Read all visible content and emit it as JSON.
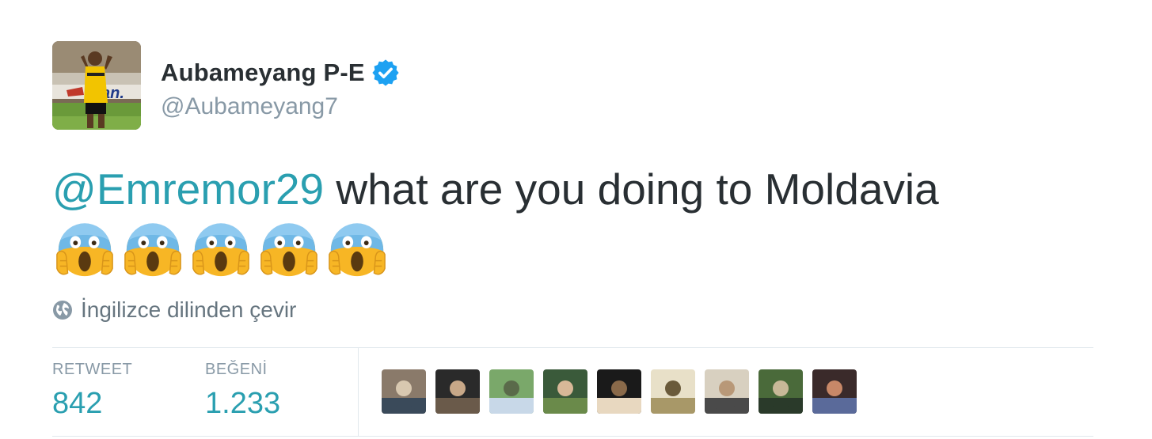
{
  "user": {
    "display_name": "Aubameyang P-E",
    "screen_name": "@Aubameyang7",
    "verified": true,
    "avatar_icon": "user-avatar-photo"
  },
  "tweet": {
    "mention": "@Emremor29",
    "text": " what are you doing to Moldavia",
    "emoji_name": "face-screaming-in-fear",
    "emoji_count": 5
  },
  "translate": {
    "icon": "globe-icon",
    "label": "İngilizce dilinden çevir"
  },
  "stats": {
    "retweet_label": "RETWEET",
    "retweet_count": "842",
    "like_label": "BEĞENİ",
    "like_count": "1.233"
  },
  "likers": [
    {
      "name": "liker-avatar-1"
    },
    {
      "name": "liker-avatar-2"
    },
    {
      "name": "liker-avatar-3"
    },
    {
      "name": "liker-avatar-4"
    },
    {
      "name": "liker-avatar-5"
    },
    {
      "name": "liker-avatar-6"
    },
    {
      "name": "liker-avatar-7"
    },
    {
      "name": "liker-avatar-8"
    },
    {
      "name": "liker-avatar-9"
    }
  ],
  "colors": {
    "link": "#2a9fb0",
    "text": "#292f33",
    "muted": "#8899a6",
    "verified": "#1da1f2",
    "divider": "#e1e8ed"
  }
}
